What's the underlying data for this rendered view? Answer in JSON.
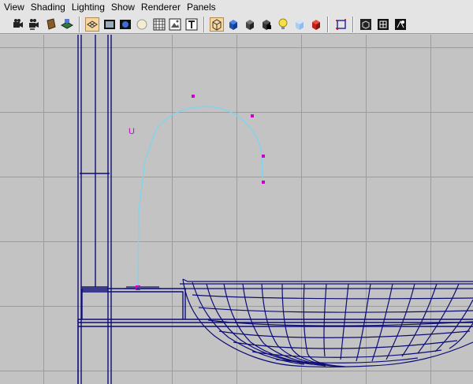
{
  "menubar": {
    "items": [
      {
        "id": "view",
        "label": "View"
      },
      {
        "id": "shading",
        "label": "Shading"
      },
      {
        "id": "lighting",
        "label": "Lighting"
      },
      {
        "id": "show",
        "label": "Show"
      },
      {
        "id": "renderer",
        "label": "Renderer"
      },
      {
        "id": "panels",
        "label": "Panels"
      }
    ]
  },
  "toolbar": {
    "icons": [
      "select-camera-icon",
      "camera-attributes-icon",
      "bookmarks-icon",
      "image-plane-icon",
      "wireframe-toggle-icon",
      "film-gate-icon",
      "resolution-gate-icon",
      "gate-mask-icon",
      "field-chart-icon",
      "safe-action-icon",
      "safe-title-icon",
      "wireframe-shading-icon",
      "smooth-shade-icon",
      "flat-shade-icon",
      "bounding-box-icon",
      "use-default-light-icon",
      "xray-icon",
      "textured-icon",
      "isolate-select-icon",
      "shadows-icon",
      "high-quality-icon",
      "motion-blur-icon"
    ]
  },
  "viewport": {
    "curve_label": "U",
    "colors": {
      "background": "#c3c3c3",
      "grid": "#9c9c9c",
      "wireframe": "#0d0d76",
      "curve": "#7fd4ef",
      "control_vertex": "#cc00cc"
    }
  }
}
